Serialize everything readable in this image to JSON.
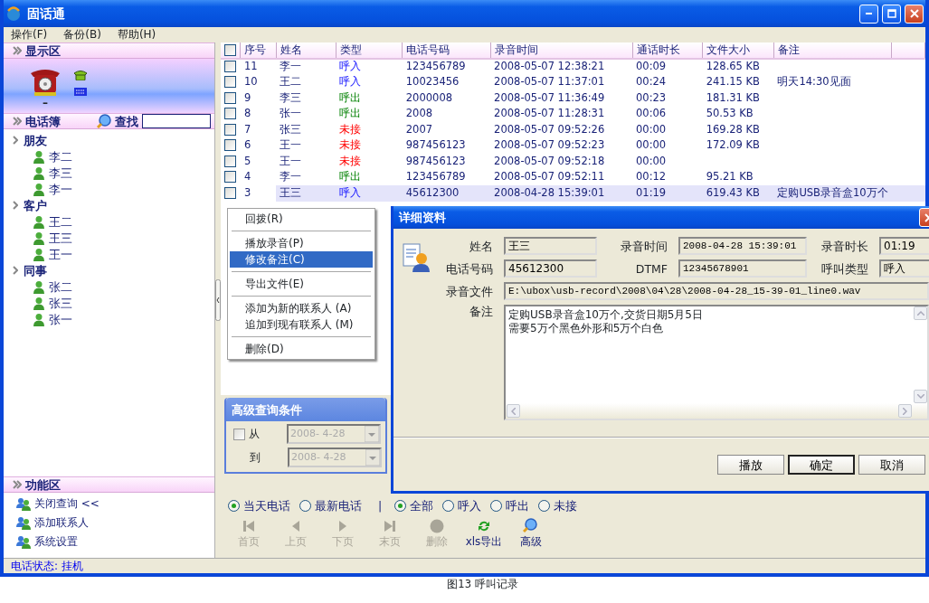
{
  "window": {
    "title": "固话通"
  },
  "menu": [
    "操作(F)",
    "备份(B)",
    "帮助(H)"
  ],
  "sidebar": {
    "display": {
      "title": "显示区",
      "line_status": "–"
    },
    "phonebook": {
      "title": "电话簿",
      "search_label": "查找",
      "groups": [
        {
          "label": "朋友",
          "contacts": [
            "李二",
            "李三",
            "李一"
          ]
        },
        {
          "label": "客户",
          "contacts": [
            "王二",
            "王三",
            "王一"
          ]
        },
        {
          "label": "同事",
          "contacts": [
            "张二",
            "张三",
            "张一"
          ]
        }
      ]
    },
    "functions": {
      "title": "功能区",
      "items": [
        "关闭查询 <<",
        "添加联系人",
        "系统设置"
      ]
    }
  },
  "table": {
    "all_checked": false,
    "columns": [
      "序号",
      "姓名",
      "类型",
      "电话号码",
      "录音时间",
      "通话时长",
      "文件大小",
      "备注"
    ],
    "rows": [
      {
        "no": "11",
        "name": "李一",
        "type": "呼入",
        "kind": "in",
        "phone": "123456789",
        "time": "2008-05-07 12:38:21",
        "duration": "00:09",
        "size": "128.65 KB",
        "checked": false,
        "selected": false
      },
      {
        "no": "10",
        "name": "王二",
        "type": "呼入",
        "kind": "in",
        "phone": "10023456",
        "time": "2008-05-07 11:37:01",
        "duration": "00:24",
        "size": "241.15 KB",
        "note": "明天14:30见面",
        "checked": false,
        "selected": false
      },
      {
        "no": "9",
        "name": "李三",
        "type": "呼出",
        "kind": "out",
        "phone": "2000008",
        "time": "2008-05-07 11:36:49",
        "duration": "00:23",
        "size": "181.31 KB",
        "checked": false,
        "selected": false
      },
      {
        "no": "8",
        "name": "张一",
        "type": "呼出",
        "kind": "out",
        "phone": "2008",
        "time": "2008-05-07 11:28:31",
        "duration": "00:06",
        "size": "50.53 KB",
        "checked": false,
        "selected": false
      },
      {
        "no": "7",
        "name": "张三",
        "type": "未接",
        "kind": "missed",
        "phone": "2007",
        "time": "2008-05-07 09:52:26",
        "duration": "00:00",
        "size": "169.28 KB",
        "checked": false,
        "selected": false
      },
      {
        "no": "6",
        "name": "王一",
        "type": "未接",
        "kind": "missed",
        "phone": "987456123",
        "time": "2008-05-07 09:52:23",
        "duration": "00:00",
        "size": "172.09 KB",
        "checked": false,
        "selected": false
      },
      {
        "no": "5",
        "name": "王一",
        "type": "未接",
        "kind": "missed",
        "phone": "987456123",
        "time": "2008-05-07 09:52:18",
        "duration": "00:00",
        "checked": false,
        "selected": false
      },
      {
        "no": "4",
        "name": "李一",
        "type": "呼出",
        "kind": "out",
        "phone": "123456789",
        "time": "2008-05-07 09:52:11",
        "duration": "00:12",
        "size": "95.21 KB",
        "checked": false,
        "selected": false
      },
      {
        "no": "3",
        "name": "王三",
        "type": "呼入",
        "kind": "in",
        "phone": "45612300",
        "time": "2008-04-28 15:39:01",
        "duration": "01:19",
        "size": "619.43 KB",
        "note": "定购USB录音盒10万个",
        "checked": false,
        "selected": true
      }
    ]
  },
  "context_menu": {
    "groups": [
      [
        {
          "label": "回拨(R)",
          "selected": false
        }
      ],
      [
        {
          "label": "播放录音(P)",
          "selected": false
        },
        {
          "label": "修改备注(C)",
          "selected": true
        }
      ],
      [
        {
          "label": "导出文件(E)",
          "selected": false
        }
      ],
      [
        {
          "label": "添加为新的联系人 (A)",
          "selected": false
        },
        {
          "label": "追加到现有联系人 (M)",
          "selected": false
        }
      ],
      [
        {
          "label": "删除(D)",
          "selected": false
        }
      ]
    ]
  },
  "advanced_query": {
    "title": "高级查询条件",
    "from_label": "从",
    "from_checked": false,
    "from_date": "2008- 4-28",
    "to_label": "到",
    "to_date": "2008- 4-28"
  },
  "filters": {
    "period": [
      {
        "label": "当天电话",
        "selected": true
      },
      {
        "label": "最新电话",
        "selected": false
      }
    ],
    "separator": "|",
    "type": [
      {
        "label": "全部",
        "selected": true
      },
      {
        "label": "呼入",
        "selected": false
      },
      {
        "label": "呼出",
        "selected": false
      },
      {
        "label": "未接",
        "selected": false
      }
    ]
  },
  "toolbar": [
    {
      "label": "首页",
      "kind": "first",
      "disabled": true
    },
    {
      "label": "上页",
      "kind": "prev",
      "disabled": true
    },
    {
      "label": "下页",
      "kind": "next",
      "disabled": true
    },
    {
      "label": "末页",
      "kind": "last",
      "disabled": true
    },
    {
      "label": "删除",
      "kind": "delete",
      "disabled": true
    },
    {
      "label": "xls导出",
      "kind": "export",
      "disabled": false
    },
    {
      "label": "高级",
      "kind": "advanced",
      "disabled": false
    }
  ],
  "status_bar": "电话状态: 挂机",
  "dialog": {
    "title": "详细资料",
    "fields": [
      {
        "label": "姓名",
        "value": "王三"
      },
      {
        "label": "录音时间",
        "value": "2008-04-28 15:39:01"
      },
      {
        "label": "录音时长",
        "value": "01:19"
      },
      {
        "label": "电话号码",
        "value": "45612300"
      },
      {
        "label": "DTMF",
        "value": "12345678901"
      },
      {
        "label": "呼叫类型",
        "value": "呼入"
      }
    ],
    "file_label": "录音文件",
    "file": "E:\\ubox\\usb-record\\2008\\04\\28\\2008-04-28_15-39-01_line0.wav",
    "note_label": "备注",
    "note_lines": [
      "定购USB录音盒10万个,交货日期5月5日",
      "需要5万个黑色外形和5万个白色"
    ],
    "buttons": [
      {
        "label": "播放",
        "default": false
      },
      {
        "label": "确定",
        "default": true
      },
      {
        "label": "取消",
        "default": false
      }
    ]
  },
  "caption": "图13 呼叫记录"
}
